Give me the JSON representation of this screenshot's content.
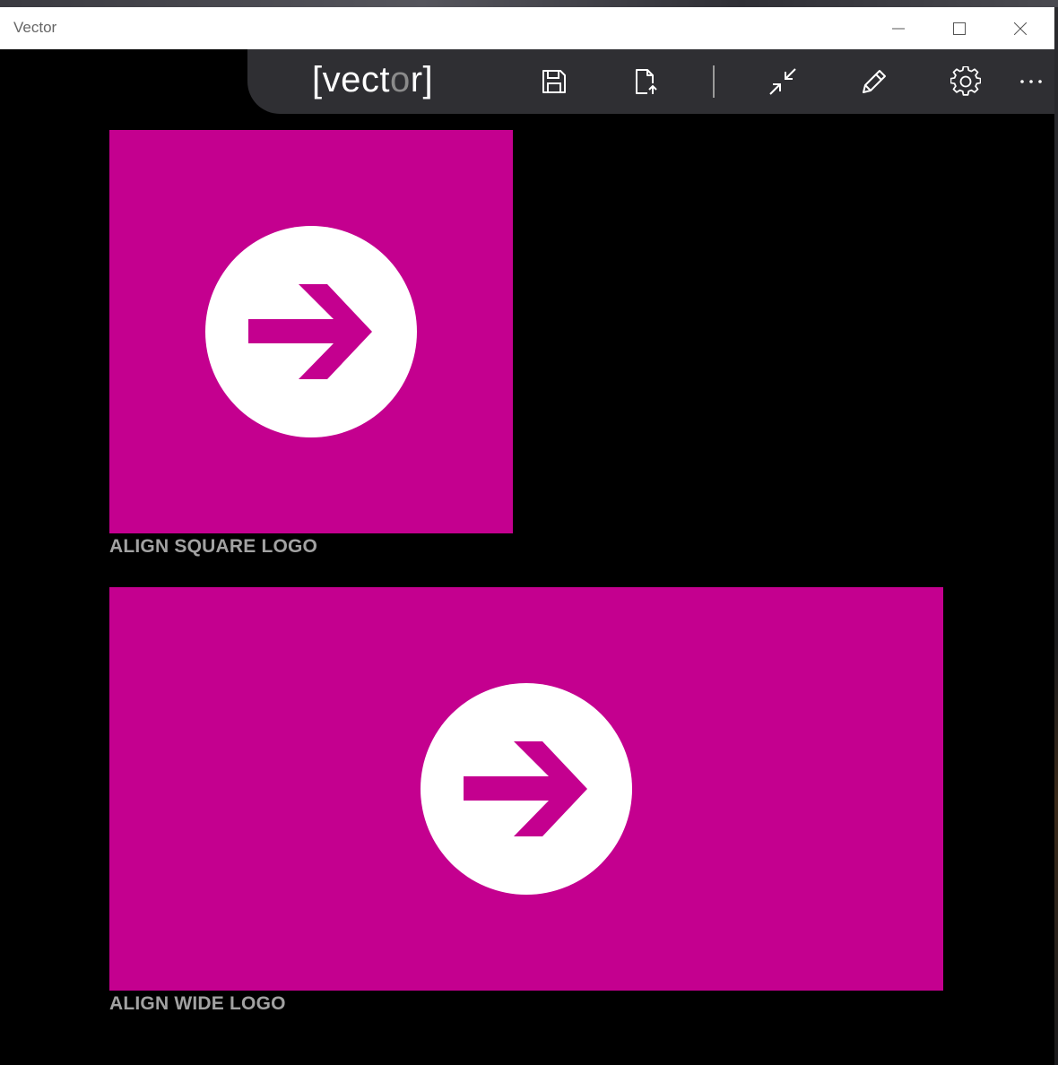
{
  "window": {
    "title": "Vector"
  },
  "toolbar": {
    "brand_prefix": "[vect",
    "brand_dim": "o",
    "brand_suffix": "r]",
    "buttons": [
      "save-icon",
      "export-icon",
      "collapse-icon",
      "edit-icon",
      "settings-icon",
      "more-icon"
    ]
  },
  "tiles": [
    {
      "label": "ALIGN SQUARE LOGO",
      "kind": "square"
    },
    {
      "label": "ALIGN WIDE LOGO",
      "kind": "wide"
    }
  ],
  "colors": {
    "tile_background": "#c4008f",
    "toolbar_background": "#2f2f33",
    "label_text": "#a2a2a2"
  }
}
